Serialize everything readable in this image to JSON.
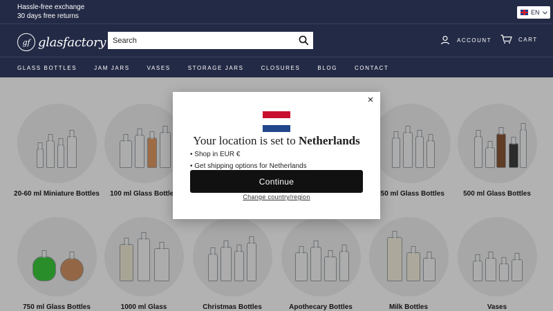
{
  "topbar": {
    "promo_1": "Hassle-free exchange",
    "promo_2": "30 days free returns",
    "language": "EN",
    "language_flag_icon": "uk-flag-icon"
  },
  "header": {
    "logo_mark": "gf",
    "logo_text": "glasfactory",
    "search_placeholder": "Search",
    "account_label": "ACCOUNT",
    "cart_label": "CART",
    "nav": [
      "GLASS BOTTLES",
      "JAM JARS",
      "VASES",
      "STORAGE JARS",
      "CLOSURES",
      "BLOG",
      "CONTACT"
    ]
  },
  "categories": {
    "row1": [
      "20-60 ml Miniature Bottles",
      "100 ml Glass Bottles",
      "",
      "",
      "250 ml Glass Bottles",
      "500 ml Glass Bottles"
    ],
    "row2": [
      "750 ml Glass Bottles",
      "1000 ml Glass",
      "Christmas Bottles",
      "Apothecary Bottles",
      "Milk Bottles",
      "Vases"
    ]
  },
  "modal": {
    "title_prefix": "Your location is set to",
    "country": "Netherlands",
    "bullet_1": "• Shop in EUR €",
    "bullet_2": "• Get shipping options for Netherlands",
    "continue_label": "Continue",
    "change_label": "Change country/region",
    "close_icon": "×",
    "flag_colors": [
      "#c8102e",
      "#ffffff",
      "#21468b"
    ]
  },
  "colors": {
    "brand_navy": "#232a45",
    "button_black": "#111111"
  }
}
